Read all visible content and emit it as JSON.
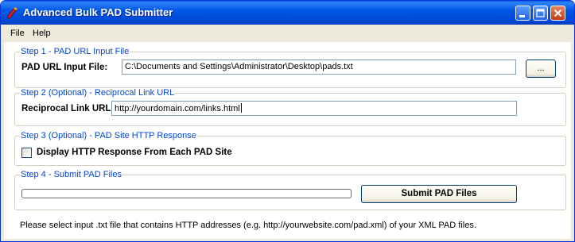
{
  "window": {
    "title": "Advanced Bulk PAD Submitter",
    "accent": "#0054e3"
  },
  "menu": {
    "items": [
      "File",
      "Help"
    ]
  },
  "step1": {
    "legend": "Step 1 - PAD URL Input File",
    "label": "PAD URL Input File:",
    "value": "C:\\Documents and Settings\\Administrator\\Desktop\\pads.txt",
    "browse_label": "..."
  },
  "step2": {
    "legend": "Step 2 (Optional) - Reciprocal Link URL",
    "label": "Reciprocal Link URL:",
    "value": "http://yourdomain.com/links.html"
  },
  "step3": {
    "legend": "Step 3 (Optional) - PAD Site HTTP Response",
    "checkbox_label": "Display HTTP Response From Each PAD Site",
    "checked": false
  },
  "step4": {
    "legend": "Step 4 - Submit PAD Files",
    "progress": 0,
    "submit_label": "Submit PAD Files"
  },
  "status": {
    "text": "Please select input .txt file that contains HTTP addresses (e.g. http://yourwebsite.com/pad.xml) of your XML PAD files."
  }
}
